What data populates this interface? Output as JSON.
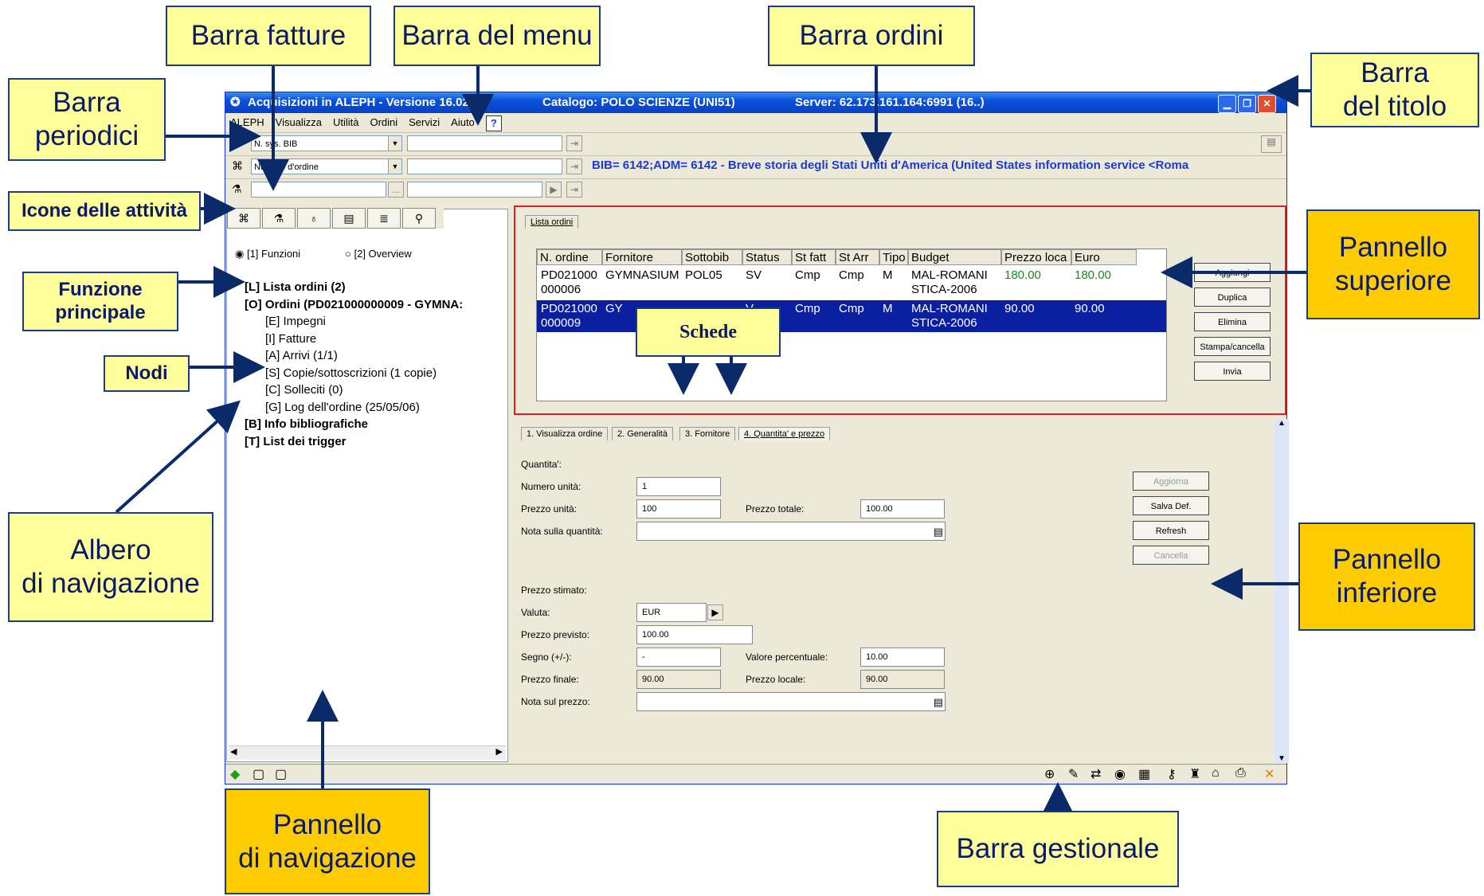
{
  "window": {
    "title": "Acquisizioni in ALEPH  - Versione 16.02",
    "catalog": "Catalogo:  POLO SCIENZE (UNI51)",
    "server": "Server:  62.173.161.164:6991 (16..)"
  },
  "menu": {
    "items": [
      "ALEPH",
      "Visualizza",
      "Utilità",
      "Ordini",
      "Servizi",
      "Aiuto"
    ],
    "help_label": "?"
  },
  "periodici_bar": {
    "combo_value": "N. sys. BIB"
  },
  "ordini_bar": {
    "combo_value": "Numero d'ordine",
    "bib_info": "BIB= 6142;ADM= 6142 - Breve storia degli Stati Uniti d'America (United States information service <Roma"
  },
  "fatture_bar": {
    "browse_label": "..."
  },
  "activity_tabs": [
    "⌘",
    "⚗",
    "♁",
    "▤",
    "≣",
    "⚲"
  ],
  "nav": {
    "radio_functions": "[1] Funzioni",
    "radio_overview": "[2] Overview",
    "tree": [
      {
        "label": "[L] Lista ordini (2)",
        "bold": true,
        "indent": 0
      },
      {
        "label": "[O] Ordini (PD021000000009 - GYMNA:",
        "bold": true,
        "indent": 0
      },
      {
        "label": "[E] Impegni",
        "bold": false,
        "indent": 1
      },
      {
        "label": "[I] Fatture",
        "bold": false,
        "indent": 1
      },
      {
        "label": "[A] Arrivi (1/1)",
        "bold": false,
        "indent": 1
      },
      {
        "label": "[S] Copie/sottoscrizioni (1 copie)",
        "bold": false,
        "indent": 1
      },
      {
        "label": "[C] Solleciti (0)",
        "bold": false,
        "indent": 1
      },
      {
        "label": "[G] Log dell'ordine (25/05/06)",
        "bold": false,
        "indent": 1
      },
      {
        "label": "[B] Info bibliografiche",
        "bold": true,
        "indent": 0
      },
      {
        "label": "[T] List dei trigger",
        "bold": true,
        "indent": 0
      }
    ]
  },
  "upper_panel": {
    "tab": "Lista ordini",
    "columns": [
      "N. ordine",
      "Fornitore",
      "Sottobib",
      "Status",
      "St fatt",
      "St Arr",
      "Tipo",
      "Budget",
      "Prezzo loca",
      "Euro"
    ],
    "rows": [
      [
        "PD021000\n000006",
        "GYMNASIUM",
        "POL05",
        "SV",
        "Cmp",
        "Cmp",
        "M",
        "MAL-ROMANI\nSTICA-2006",
        "180.00",
        "180.00"
      ],
      [
        "PD021000\n000009",
        "GY",
        "",
        "V",
        "Cmp",
        "Cmp",
        "M",
        "MAL-ROMANI\nSTICA-2006",
        "90.00",
        "90.00"
      ]
    ],
    "buttons": [
      "Aggiungi",
      "Duplica",
      "Elimina",
      "Stampa/cancella",
      "Invia"
    ]
  },
  "lower_panel": {
    "tabs": [
      "1. Visualizza ordine",
      "2. Generalità",
      "3. Fornitore",
      "4. Quantita' e prezzo"
    ],
    "quantita_label": "Quantita':",
    "numero_unita_label": "Numero unità:",
    "numero_unita": "1",
    "prezzo_unita_label": "Prezzo unità:",
    "prezzo_unita": "100",
    "prezzo_totale_label": "Prezzo totale:",
    "prezzo_totale": "100.00",
    "nota_quantita_label": "Nota sulla quantità:",
    "prezzo_stimato_label": "Prezzo stimato:",
    "valuta_label": "Valuta:",
    "valuta": "EUR",
    "prezzo_previsto_label": "Prezzo previsto:",
    "prezzo_previsto": "100.00",
    "segno_label": "Segno (+/-):",
    "segno": "-",
    "valore_percentuale_label": "Valore percentuale:",
    "valore_percentuale": "10.00",
    "prezzo_finale_label": "Prezzo finale:",
    "prezzo_finale": "90.00",
    "prezzo_locale_label": "Prezzo locale:",
    "prezzo_locale": "90.00",
    "nota_prezzo_label": "Nota sul prezzo:",
    "buttons": [
      "Aggiorna",
      "Salva Def.",
      "Refresh",
      "Cancella"
    ]
  },
  "statusbar": {
    "left_icons": [
      "◆",
      "▢",
      "▢"
    ],
    "right_icons": [
      "⊕",
      "✎",
      "⇄",
      "◉",
      "▦",
      "⚷",
      "♜",
      "⌂",
      "⎙",
      "✕"
    ]
  },
  "callouts": {
    "barra_fatture": "Barra fatture",
    "barra_menu": "Barra del menu",
    "barra_ordini": "Barra ordini",
    "barra_titolo": "Barra\ndel titolo",
    "barra_periodici": "Barra\nperiodici",
    "icone_attivita": "Icone delle attività",
    "funzione_principale": "Funzione\nprincipale",
    "nodi": "Nodi",
    "albero": "Albero\ndi navigazione",
    "pannello_superiore": "Pannello\nsuperiore",
    "schede": "Schede",
    "pannello_inferiore": "Pannello\ninferiore",
    "pannello_navigazione": "Pannello\ndi navigazione",
    "barra_gestionale": "Barra gestionale"
  },
  "colors": {
    "callout_light": "#ffff99",
    "callout_gold": "#ffcc00",
    "title_blue": "#0a50d8",
    "selection": "#0a1fa0",
    "highlight_red": "#e02020"
  }
}
